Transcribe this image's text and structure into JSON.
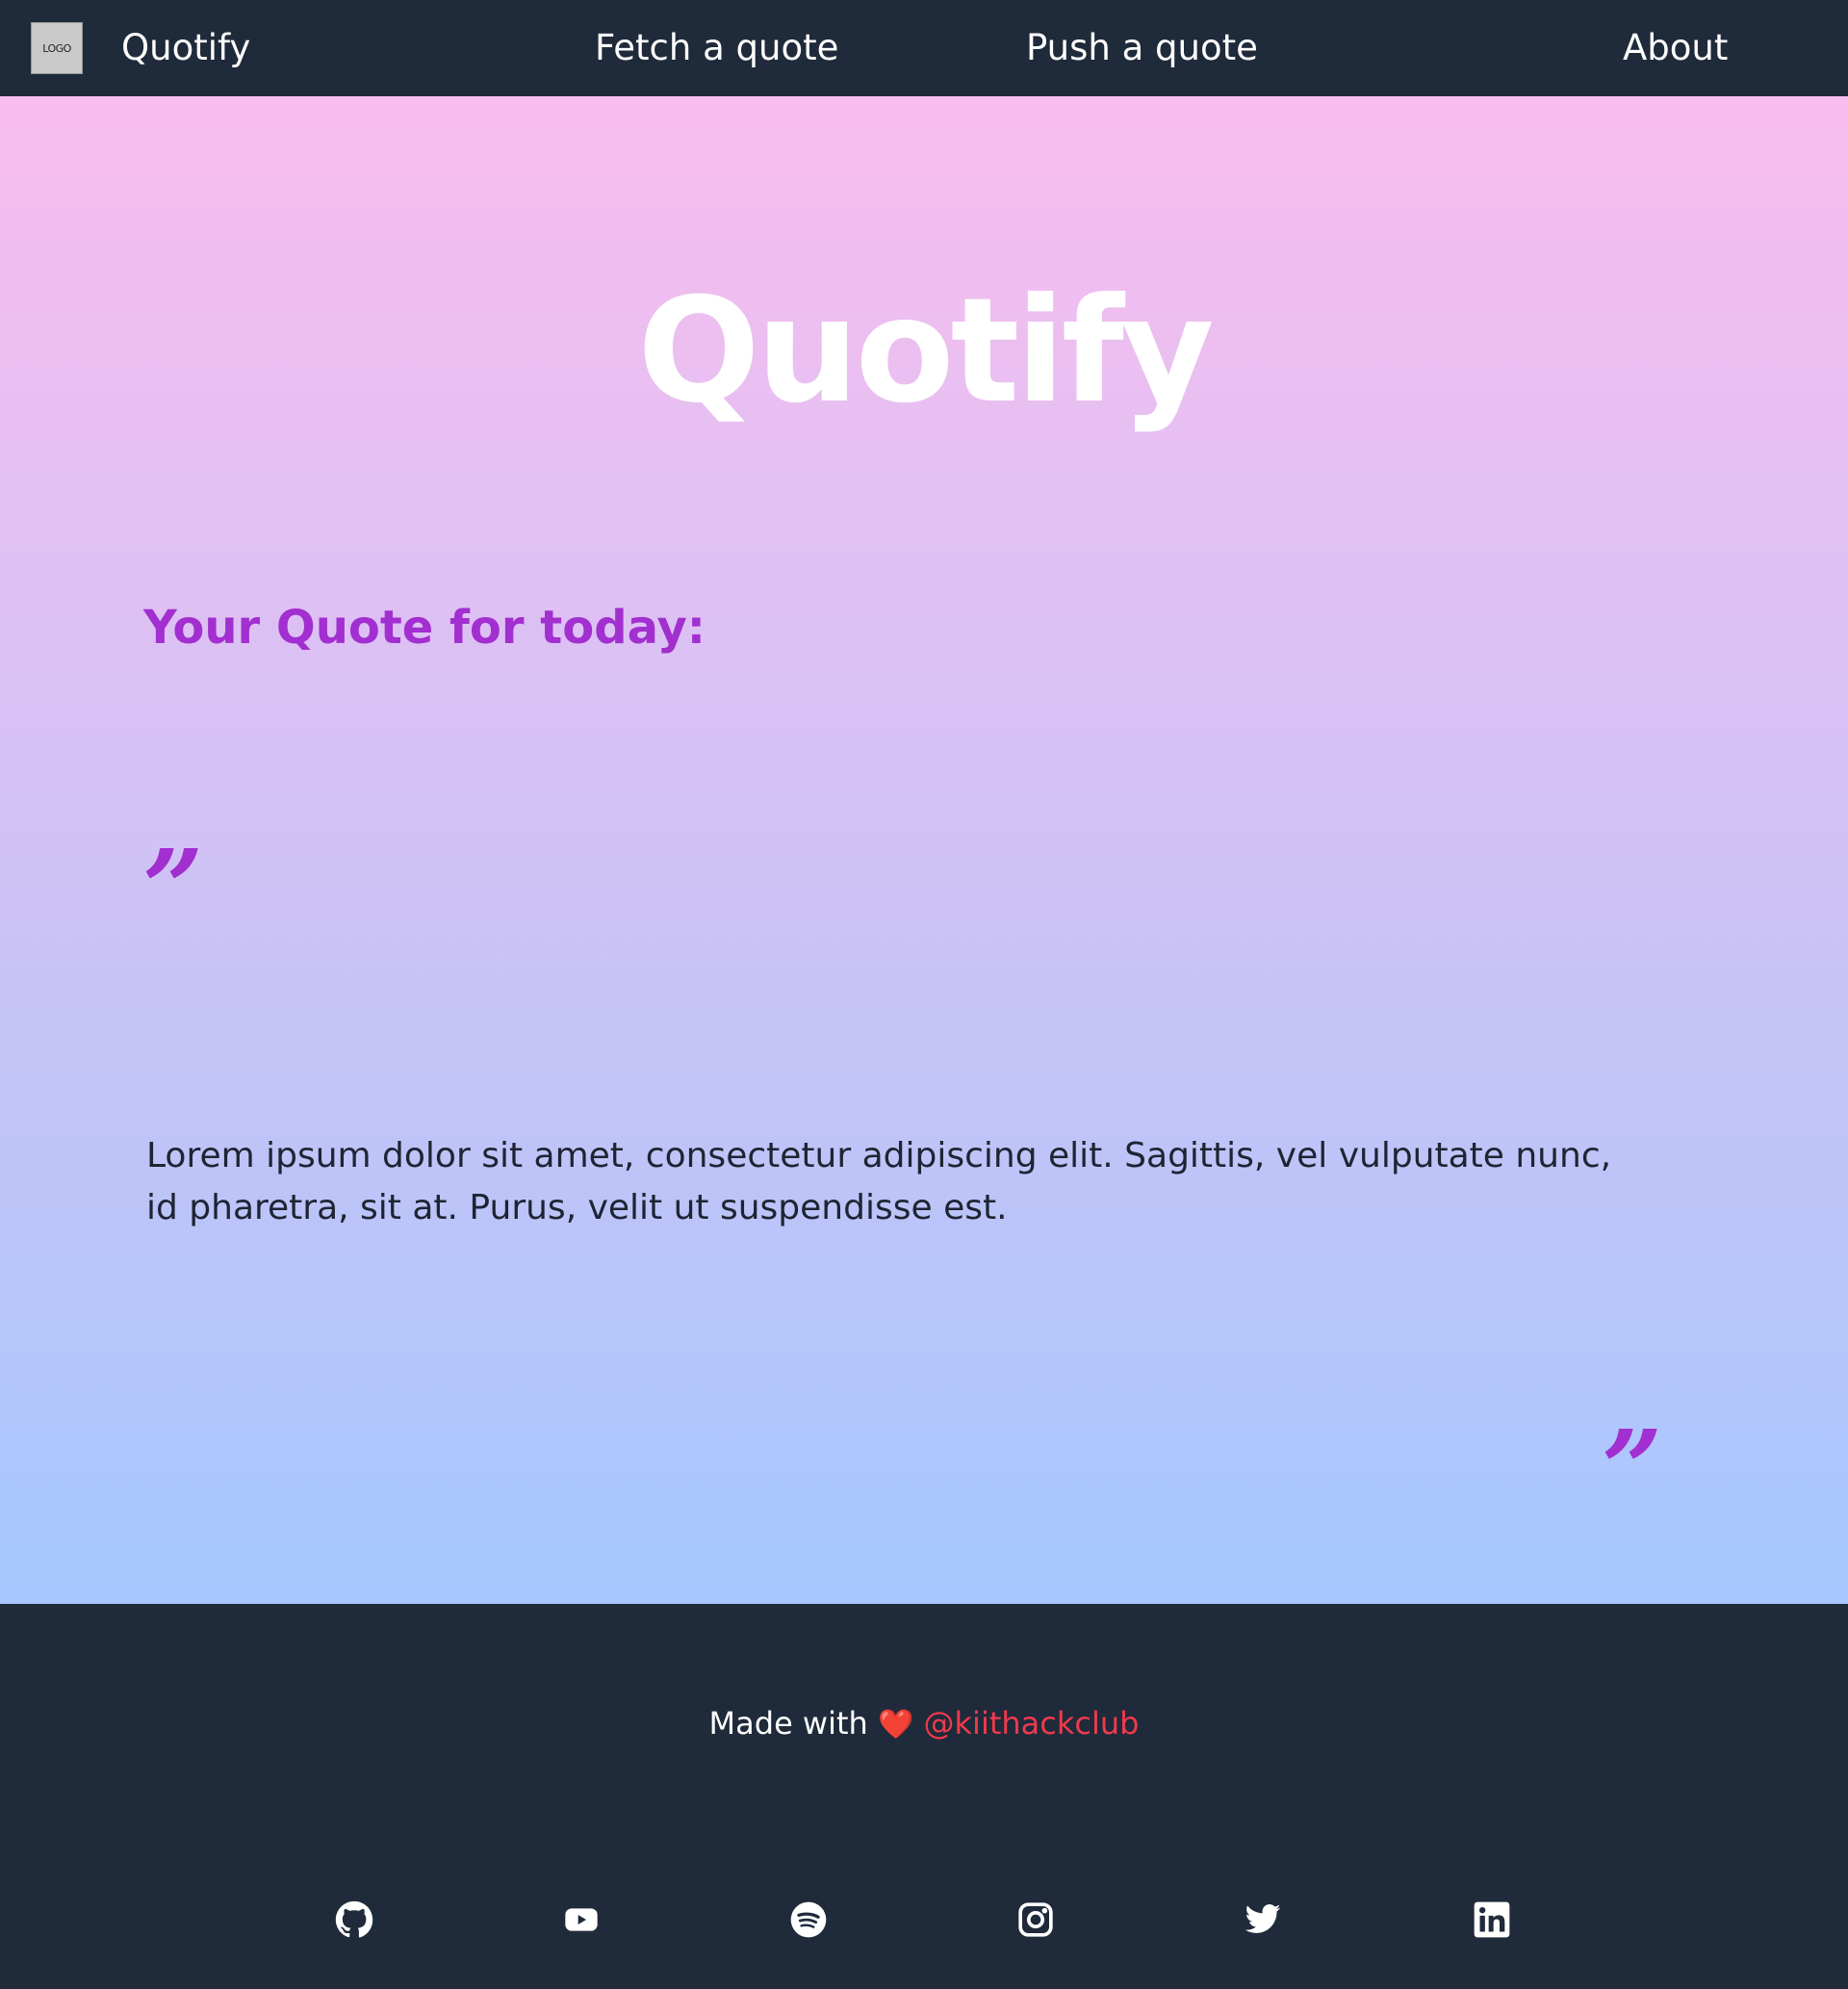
{
  "nav": {
    "logo_text": "LOGO",
    "brand": "Quotify",
    "links": [
      "Fetch a quote",
      "Push a quote",
      "About"
    ]
  },
  "hero": {
    "title": "Quotify",
    "heading": "Your Quote for today:",
    "open_mark": "”",
    "close_mark": "”",
    "quote": "Lorem ipsum dolor sit amet, consectetur adipiscing elit. Sagittis, vel vulputate nunc, id pharetra, sit at. Purus, velit ut suspendisse est."
  },
  "footer": {
    "made_with": "Made with",
    "heart": "❤️",
    "handle": "@kiithackclub",
    "socials": [
      "github-icon",
      "youtube-icon",
      "spotify-icon",
      "instagram-icon",
      "twitter-icon",
      "linkedin-icon"
    ]
  },
  "colors": {
    "nav_bg": "#1f2a3a",
    "accent_purple": "#a22fcf",
    "handle_red": "#ef3a4c",
    "gradient_top": "#f9bdee",
    "gradient_bottom": "#a6c8fe"
  }
}
